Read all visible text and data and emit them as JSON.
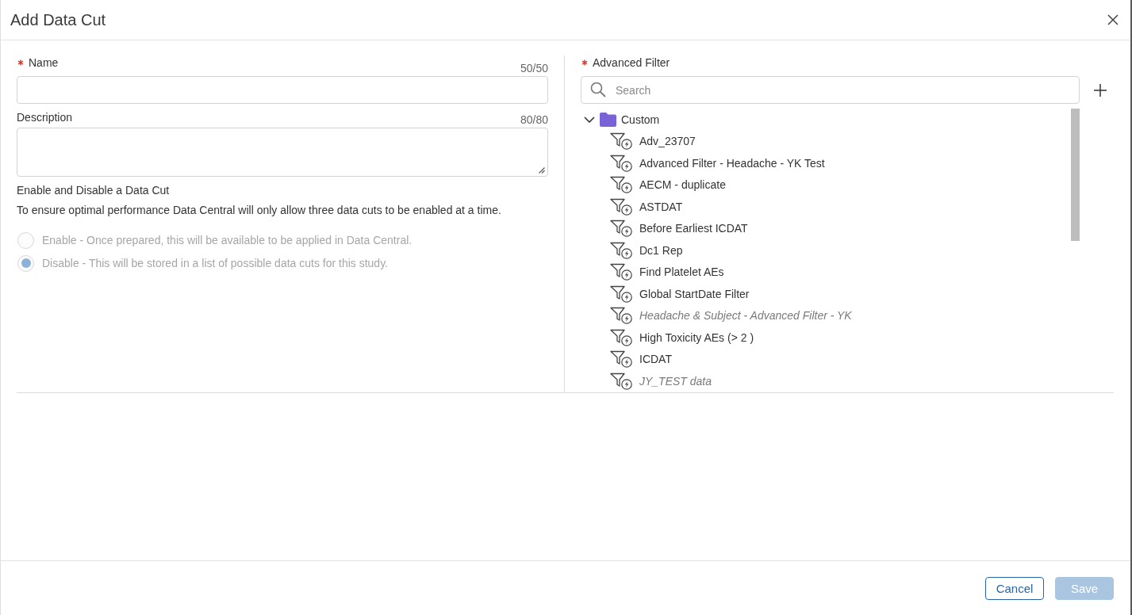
{
  "dialog": {
    "title": "Add Data Cut"
  },
  "name_field": {
    "label": "Name",
    "required": true,
    "counter": "50/50"
  },
  "description_field": {
    "label": "Description",
    "counter": "80/80"
  },
  "enable_section": {
    "heading": "Enable and Disable a Data Cut",
    "note": "To ensure optimal performance Data Central will only allow three data cuts to be enabled at a time.",
    "options": [
      {
        "label": "Enable - Once prepared, this will be available to be applied in Data Central.",
        "selected": false,
        "disabled": true
      },
      {
        "label": "Disable - This will be stored in a list of possible data cuts for this study.",
        "selected": true,
        "disabled": true
      }
    ]
  },
  "advanced_filter": {
    "label": "Advanced Filter",
    "required": true,
    "search": {
      "placeholder": "Search"
    },
    "tree": [
      {
        "label": "Custom",
        "expanded": true,
        "children": [
          {
            "label": "Adv_23707",
            "disabled": false
          },
          {
            "label": "Advanced Filter - Headache - YK Test",
            "disabled": false
          },
          {
            "label": "AECM - duplicate",
            "disabled": false
          },
          {
            "label": "ASTDAT",
            "disabled": false
          },
          {
            "label": "Before Earliest ICDAT",
            "disabled": false
          },
          {
            "label": "Dc1 Rep",
            "disabled": false
          },
          {
            "label": "Find Platelet AEs",
            "disabled": false
          },
          {
            "label": "Global StartDate Filter",
            "disabled": false
          },
          {
            "label": "Headache & Subject - Advanced Filter - YK",
            "disabled": true
          },
          {
            "label": "High Toxicity AEs (> 2 )",
            "disabled": false
          },
          {
            "label": "ICDAT",
            "disabled": false
          },
          {
            "label": "JY_TEST data",
            "disabled": true
          }
        ]
      }
    ]
  },
  "buttons": [
    {
      "label": "Cancel",
      "kind": "outline",
      "disabled": false
    },
    {
      "label": "Save",
      "kind": "primary",
      "disabled": true
    }
  ]
}
